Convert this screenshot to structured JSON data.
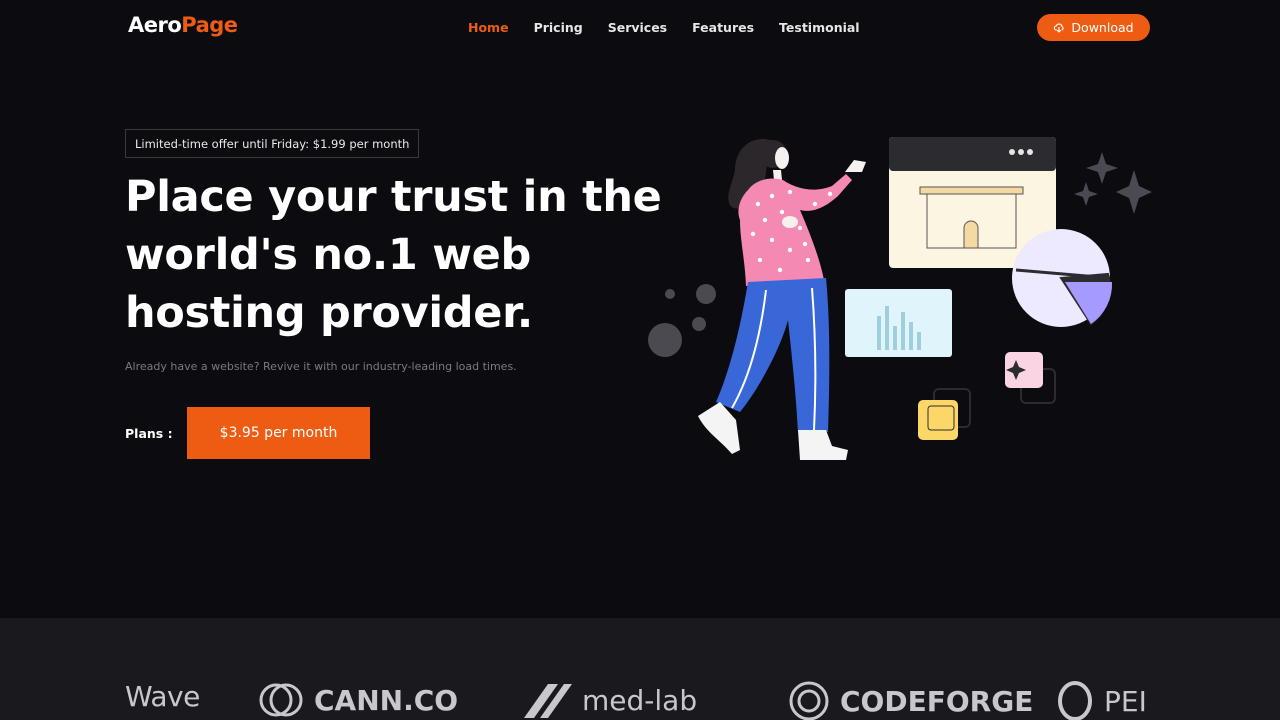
{
  "logo": {
    "part1": "Aero",
    "part2": "Page"
  },
  "nav": {
    "items": [
      {
        "label": "Home"
      },
      {
        "label": "Pricing"
      },
      {
        "label": "Services"
      },
      {
        "label": "Features"
      },
      {
        "label": "Testimonial"
      }
    ],
    "download_label": "Download"
  },
  "hero": {
    "offer": "Limited-time offer until Friday: $1.99 per month",
    "headline": "Place your trust in the world's no.1 web hosting provider.",
    "subtext": "Already have a website? Revive it with our industry-leading load times.",
    "plans_label": "Plans :",
    "cta_label": "$3.95 per month"
  },
  "brands": [
    "Wave",
    "CANN.CO",
    "med-lab",
    "CODEFORGE",
    "PEI"
  ],
  "colors": {
    "accent": "#ee5c14",
    "background": "#0c0b0f",
    "strip": "#1a191e"
  }
}
